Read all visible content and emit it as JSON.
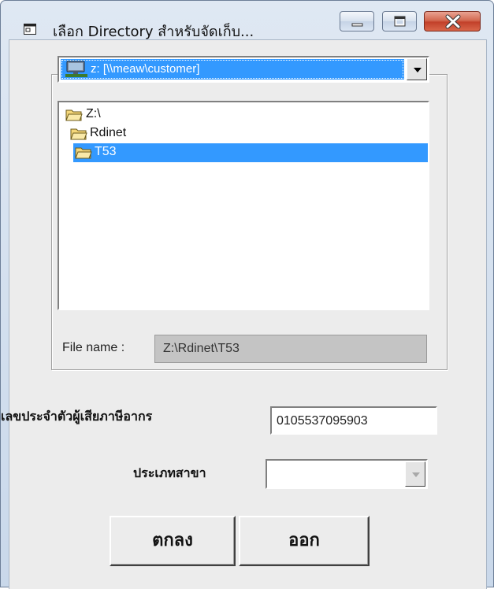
{
  "window": {
    "title": "เลือก Directory สำหรับจัดเก็บ..."
  },
  "title_buttons": {
    "minimize": "minimize-icon",
    "maximize": "maximize-icon",
    "close": "close-icon"
  },
  "drive": {
    "selected": "z: [\\\\meaw\\customer]"
  },
  "directories": [
    {
      "label": "Z:\\",
      "selected": false
    },
    {
      "label": "Rdinet",
      "selected": false
    },
    {
      "label": "T53",
      "selected": true
    }
  ],
  "file_name": {
    "label": "File name :",
    "value": "Z:\\Rdinet\\T53"
  },
  "tax_id": {
    "label": "เลขประจำตัวผู้เสียภาษีอากร",
    "value": "0105537095903"
  },
  "branch_type": {
    "label": "ประเภทสาขา",
    "value": ""
  },
  "buttons": {
    "ok": "ตกลง",
    "exit": "ออก"
  },
  "colors": {
    "selection": "#3399ff",
    "close_button": "#c2412a"
  }
}
